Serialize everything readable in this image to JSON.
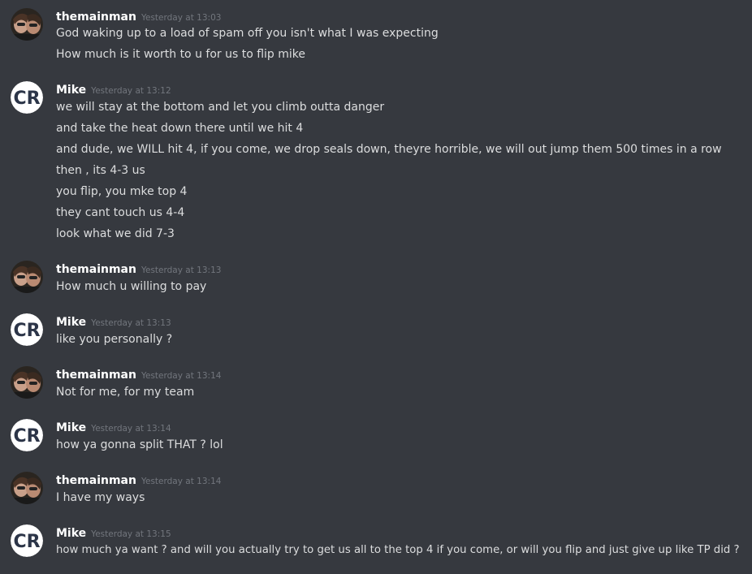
{
  "messages": [
    {
      "author": "themainman",
      "avatar": "selfie-avatar",
      "timestamp": "Yesterday at 13:03",
      "lines": [
        "God waking up to a load of spam off you isn't what I was expecting",
        "How much is it worth to u for us to flip mike"
      ]
    },
    {
      "author": "Mike",
      "avatar": "cr-logo-avatar",
      "timestamp": "Yesterday at 13:12",
      "lines": [
        "we will stay at the bottom and let you climb outta danger",
        "and take the heat down there until we hit 4",
        "and dude, we WILL hit 4, if you come, we drop seals down, theyre horrible, we will out jump them 500 times in a row",
        "then , its 4-3 us",
        "you flip, you mke top 4",
        "they cant touch us 4-4",
        "look what we did 7-3"
      ]
    },
    {
      "author": "themainman",
      "avatar": "selfie-avatar",
      "timestamp": "Yesterday at 13:13",
      "lines": [
        "How much u willing to pay"
      ]
    },
    {
      "author": "Mike",
      "avatar": "cr-logo-avatar",
      "timestamp": "Yesterday at 13:13",
      "lines": [
        "like you personally ?"
      ]
    },
    {
      "author": "themainman",
      "avatar": "selfie-avatar",
      "timestamp": "Yesterday at 13:14",
      "lines": [
        "Not for me, for my team"
      ]
    },
    {
      "author": "Mike",
      "avatar": "cr-logo-avatar",
      "timestamp": "Yesterday at 13:14",
      "lines": [
        "how ya gonna split THAT ? lol"
      ]
    },
    {
      "author": "themainman",
      "avatar": "selfie-avatar",
      "timestamp": "Yesterday at 13:14",
      "lines": [
        "I have my ways"
      ]
    },
    {
      "author": "Mike",
      "avatar": "cr-logo-avatar",
      "timestamp": "Yesterday at 13:15",
      "lines": [
        "how much ya want ? and will you actually try to get us all to the top 4 if you come, or will you flip and just give up like TP did ?"
      ]
    }
  ],
  "colors": {
    "background": "#36393f",
    "author": "#ffffff",
    "timestamp": "#72767d",
    "message_text": "#dcddde",
    "cr_logo_bg": "#ffffff",
    "cr_logo_fg": "#2c3548"
  }
}
